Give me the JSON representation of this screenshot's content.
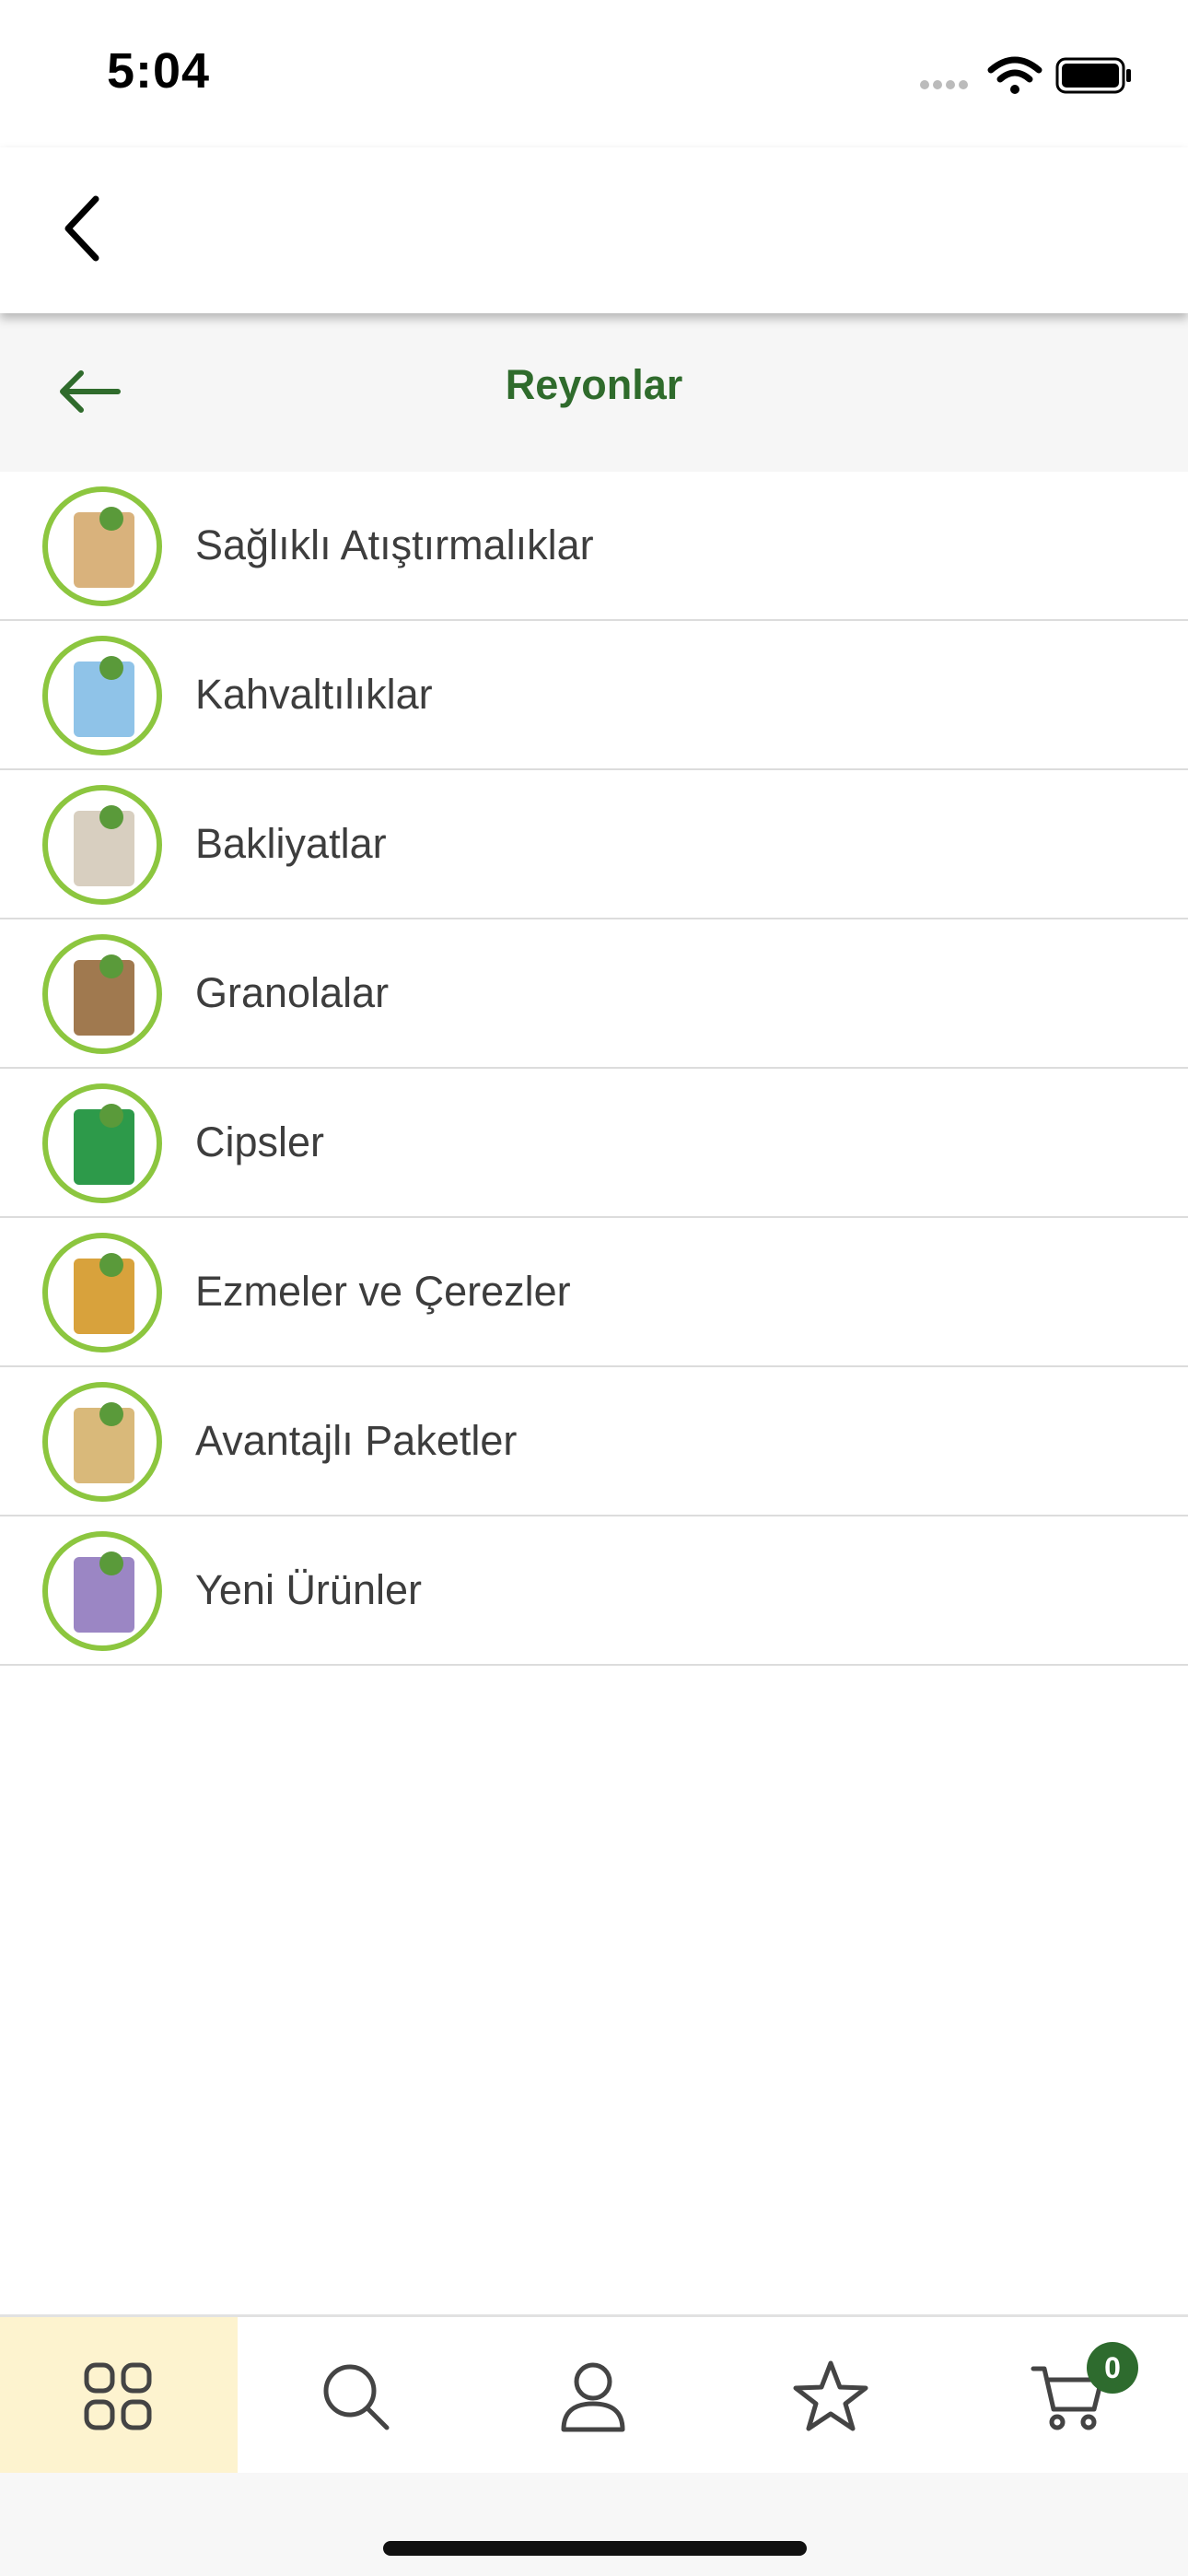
{
  "status_bar": {
    "time": "5:04"
  },
  "header": {
    "title": "Reyonlar"
  },
  "categories": [
    {
      "label": "Sağlıklı Atıştırmalıklar",
      "icon": "snack-package-thumbnail",
      "color": "#d9b27c"
    },
    {
      "label": "Kahvaltılıklar",
      "icon": "breakfast-package-thumbnail",
      "color": "#8fc3e8"
    },
    {
      "label": "Bakliyatlar",
      "icon": "legumes-package-thumbnail",
      "color": "#d8cfc0"
    },
    {
      "label": "Granolalar",
      "icon": "granola-package-thumbnail",
      "color": "#a0794f"
    },
    {
      "label": "Cipsler",
      "icon": "chips-package-thumbnail",
      "color": "#2d9a4a"
    },
    {
      "label": "Ezmeler ve Çerezler",
      "icon": "spread-jar-thumbnail",
      "color": "#d8a23c"
    },
    {
      "label": "Avantajlı Paketler",
      "icon": "bundle-boxes-thumbnail",
      "color": "#d9b97a"
    },
    {
      "label": "Yeni Ürünler",
      "icon": "new-product-thumbnail",
      "color": "#9b86c4"
    }
  ],
  "tab_bar": {
    "tabs": [
      "categories-icon",
      "search-icon",
      "profile-icon",
      "favorites-icon",
      "cart-icon"
    ],
    "active": "categories-icon",
    "cart_count": "0"
  },
  "colors": {
    "accent_green": "#2f6b2c",
    "ring_green": "#8cc63f",
    "active_tab_bg": "#fdf3cf"
  }
}
